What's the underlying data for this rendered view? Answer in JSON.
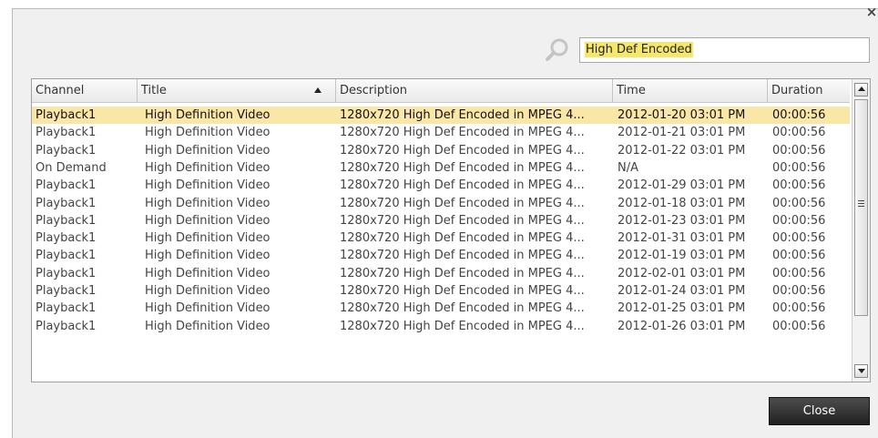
{
  "dialog": {
    "close_glyph": "×",
    "search": {
      "value": "High Def Encoded"
    },
    "close_button_label": "Close"
  },
  "table": {
    "columns": [
      {
        "label": "Channel"
      },
      {
        "label": "Title",
        "sorted": "ascending"
      },
      {
        "label": "Description"
      },
      {
        "label": "Time"
      },
      {
        "label": "Duration"
      }
    ],
    "selected_row": 0,
    "rows": [
      [
        "Playback1",
        "High Definition Video",
        "1280x720 High Def Encoded in MPEG 4...",
        "2012-01-20  03:01 PM",
        "00:00:56"
      ],
      [
        "Playback1",
        "High Definition Video",
        "1280x720 High Def Encoded in MPEG 4...",
        "2012-01-21  03:01 PM",
        "00:00:56"
      ],
      [
        "Playback1",
        "High Definition Video",
        "1280x720 High Def Encoded in MPEG 4...",
        "2012-01-22  03:01 PM",
        "00:00:56"
      ],
      [
        "On Demand",
        "High Definition Video",
        "1280x720 High Def Encoded in MPEG 4...",
        "N/A",
        "00:00:56"
      ],
      [
        "Playback1",
        "High Definition Video",
        "1280x720 High Def Encoded in MPEG 4...",
        "2012-01-29  03:01 PM",
        "00:00:56"
      ],
      [
        "Playback1",
        "High Definition Video",
        "1280x720 High Def Encoded in MPEG 4...",
        "2012-01-18  03:01 PM",
        "00:00:56"
      ],
      [
        "Playback1",
        "High Definition Video",
        "1280x720 High Def Encoded in MPEG 4...",
        "2012-01-23  03:01 PM",
        "00:00:56"
      ],
      [
        "Playback1",
        "High Definition Video",
        "1280x720 High Def Encoded in MPEG 4...",
        "2012-01-31  03:01 PM",
        "00:00:56"
      ],
      [
        "Playback1",
        "High Definition Video",
        "1280x720 High Def Encoded in MPEG 4...",
        "2012-01-19  03:01 PM",
        "00:00:56"
      ],
      [
        "Playback1",
        "High Definition Video",
        "1280x720 High Def Encoded in MPEG 4...",
        "2012-02-01  03:01 PM",
        "00:00:56"
      ],
      [
        "Playback1",
        "High Definition Video",
        "1280x720 High Def Encoded in MPEG 4...",
        "2012-01-24  03:01 PM",
        "00:00:56"
      ],
      [
        "Playback1",
        "High Definition Video",
        "1280x720 High Def Encoded in MPEG 4...",
        "2012-01-25  03:01 PM",
        "00:00:56"
      ],
      [
        "Playback1",
        "High Definition Video",
        "1280x720 High Def Encoded in MPEG 4...",
        "2012-01-26  03:01 PM",
        "00:00:56"
      ]
    ]
  },
  "colors": {
    "selected_row": "#fae6a6",
    "search_highlight": "#f5e66e",
    "close_button": "#2e2e2e"
  },
  "icons": {
    "search": "magnifier-icon",
    "close": "close-icon",
    "sort": "sort-ascending-icon"
  }
}
